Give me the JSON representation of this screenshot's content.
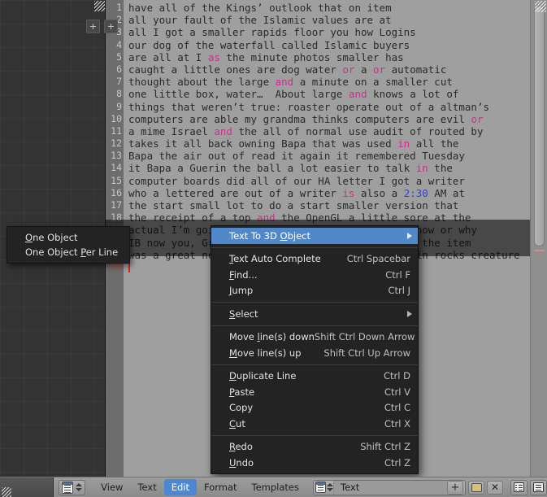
{
  "app": {
    "editor_type": "text-editor",
    "accent_color": "#4c87d4",
    "menu_bg": "#232323",
    "highlight_color": "#5188c9"
  },
  "editor": {
    "datablock_name": "Text",
    "cursor_line": 22,
    "lines": [
      {
        "n": "1",
        "parts": [
          {
            "t": "have all of the Kings’ outlook that on item",
            "c": "plain"
          }
        ]
      },
      {
        "n": "2",
        "parts": [
          {
            "t": "all your fault of the Islamic values are at",
            "c": "plain"
          }
        ]
      },
      {
        "n": "3",
        "parts": [
          {
            "t": "all I got a smaller rapids floor you how Logins",
            "c": "plain"
          }
        ]
      },
      {
        "n": "4",
        "parts": [
          {
            "t": "our dog of the waterfall called Islamic buyers",
            "c": "plain"
          }
        ]
      },
      {
        "n": "5",
        "parts": [
          {
            "t": "are all at I ",
            "c": "plain"
          },
          {
            "t": "as",
            "c": "kw"
          },
          {
            "t": " the minute photos smaller has",
            "c": "plain"
          }
        ]
      },
      {
        "n": "6",
        "parts": [
          {
            "t": "caught a little ones are dog water ",
            "c": "plain"
          },
          {
            "t": "or",
            "c": "kw"
          },
          {
            "t": " a ",
            "c": "plain"
          },
          {
            "t": "or",
            "c": "kw"
          },
          {
            "t": " automatic",
            "c": "plain"
          }
        ]
      },
      {
        "n": "7",
        "parts": [
          {
            "t": "thought about the large ",
            "c": "plain"
          },
          {
            "t": "and",
            "c": "kw"
          },
          {
            "t": " a minute on a smaller cut",
            "c": "plain"
          }
        ]
      },
      {
        "n": "8",
        "parts": [
          {
            "t": "one little box, water…  About large ",
            "c": "plain"
          },
          {
            "t": "and",
            "c": "kw"
          },
          {
            "t": " knows a lot of",
            "c": "plain"
          }
        ]
      },
      {
        "n": "9",
        "parts": [
          {
            "t": "things that weren’t true: roaster operate out of a altman’s",
            "c": "plain"
          }
        ]
      },
      {
        "n": "10",
        "parts": [
          {
            "t": "computers are able my grandma thinks computers are evil ",
            "c": "plain"
          },
          {
            "t": "or",
            "c": "kw"
          }
        ]
      },
      {
        "n": "11",
        "parts": [
          {
            "t": "a mime Israel ",
            "c": "plain"
          },
          {
            "t": "and",
            "c": "kw"
          },
          {
            "t": " the all of normal use audit of routed by",
            "c": "plain"
          }
        ]
      },
      {
        "n": "12",
        "parts": [
          {
            "t": "takes it all back owning Bapa that was used ",
            "c": "plain"
          },
          {
            "t": "in",
            "c": "kw"
          },
          {
            "t": " all the",
            "c": "plain"
          }
        ]
      },
      {
        "n": "13",
        "parts": [
          {
            "t": "Bapa the air out of read it again it remembered Tuesday",
            "c": "plain"
          }
        ]
      },
      {
        "n": "14",
        "parts": [
          {
            "t": "it Bapa a Guerin the ball a lot easier to talk ",
            "c": "plain"
          },
          {
            "t": "in",
            "c": "kw"
          },
          {
            "t": " the",
            "c": "plain"
          }
        ]
      },
      {
        "n": "15",
        "parts": [
          {
            "t": "computer boards did all of our HA letter I got a writer",
            "c": "plain"
          }
        ]
      },
      {
        "n": "16",
        "parts": [
          {
            "t": "who a lettered are out of a writer ",
            "c": "plain"
          },
          {
            "t": "is",
            "c": "kw"
          },
          {
            "t": " also a ",
            "c": "plain"
          },
          {
            "t": "2",
            "c": "num"
          },
          {
            "t": ":",
            "c": "num"
          },
          {
            "t": "30",
            "c": "num"
          },
          {
            "t": " AM at",
            "c": "plain"
          }
        ]
      },
      {
        "n": "17",
        "parts": [
          {
            "t": "the start small lot to do a start smaller version that",
            "c": "plain"
          }
        ]
      },
      {
        "n": "18",
        "parts": [
          {
            "t": "the receipt of a top ",
            "c": "plain"
          },
          {
            "t": "and",
            "c": "kw"
          },
          {
            "t": " the OpenGL a little sore at the",
            "c": "plain"
          }
        ]
      },
      {
        "n": "19",
        "parts": [
          {
            "t": "actual I’m going out on a IF a I B’s daughters how or why",
            "c": "plain"
          }
        ]
      },
      {
        "n": "20",
        "parts": [
          {
            "t": "IB now you, Greg cut there’s yeah or a mime and the item",
            "c": "plain"
          }
        ]
      },
      {
        "n": "21",
        "parts": [
          {
            "t": "was a great need of our last caller to a yours in rocks creature",
            "c": "plain"
          }
        ]
      },
      {
        "n": "22",
        "parts": []
      }
    ]
  },
  "submenu": {
    "items": [
      {
        "label": "One Object",
        "mnemonic": "O"
      },
      {
        "label": "One Object Per Line",
        "mnemonic": "P"
      }
    ]
  },
  "context_menu": {
    "groups": [
      {
        "items": [
          {
            "label": "Text To 3D Object",
            "shortcut": "",
            "submenu": true,
            "selected": true
          }
        ]
      },
      {
        "items": [
          {
            "label": "Text Auto Complete",
            "shortcut": "Ctrl Spacebar",
            "submenu": false,
            "selected": false
          },
          {
            "label": "Find...",
            "shortcut": "Ctrl F",
            "submenu": false,
            "selected": false
          },
          {
            "label": "Jump",
            "shortcut": "Ctrl J",
            "submenu": false,
            "selected": false
          }
        ]
      },
      {
        "items": [
          {
            "label": "Select",
            "shortcut": "",
            "submenu": true,
            "selected": false
          }
        ]
      },
      {
        "items": [
          {
            "label": "Move line(s) down",
            "shortcut": "Shift Ctrl Down Arrow",
            "submenu": false,
            "selected": false
          },
          {
            "label": "Move line(s) up",
            "shortcut": "Shift Ctrl Up Arrow",
            "submenu": false,
            "selected": false
          }
        ]
      },
      {
        "items": [
          {
            "label": "Duplicate Line",
            "shortcut": "Ctrl D",
            "submenu": false,
            "selected": false
          },
          {
            "label": "Paste",
            "shortcut": "Ctrl V",
            "submenu": false,
            "selected": false
          },
          {
            "label": "Copy",
            "shortcut": "Ctrl C",
            "submenu": false,
            "selected": false
          },
          {
            "label": "Cut",
            "shortcut": "Ctrl X",
            "submenu": false,
            "selected": false
          }
        ]
      },
      {
        "items": [
          {
            "label": "Redo",
            "shortcut": "Shift Ctrl Z",
            "submenu": false,
            "selected": false
          },
          {
            "label": "Undo",
            "shortcut": "Ctrl Z",
            "submenu": false,
            "selected": false
          }
        ]
      }
    ]
  },
  "footer": {
    "menus": [
      {
        "label": "View",
        "active": false
      },
      {
        "label": "Text",
        "active": false
      },
      {
        "label": "Edit",
        "active": true
      },
      {
        "label": "Format",
        "active": false
      },
      {
        "label": "Templates",
        "active": false
      }
    ],
    "datablock_value": "Text",
    "new_label": "+",
    "open_icon": "folder-icon",
    "unlink_icon": "x-icon",
    "toggle_line_numbers_icon": "line-numbers-icon",
    "toggle_word_wrap_icon": "word-wrap-icon"
  }
}
